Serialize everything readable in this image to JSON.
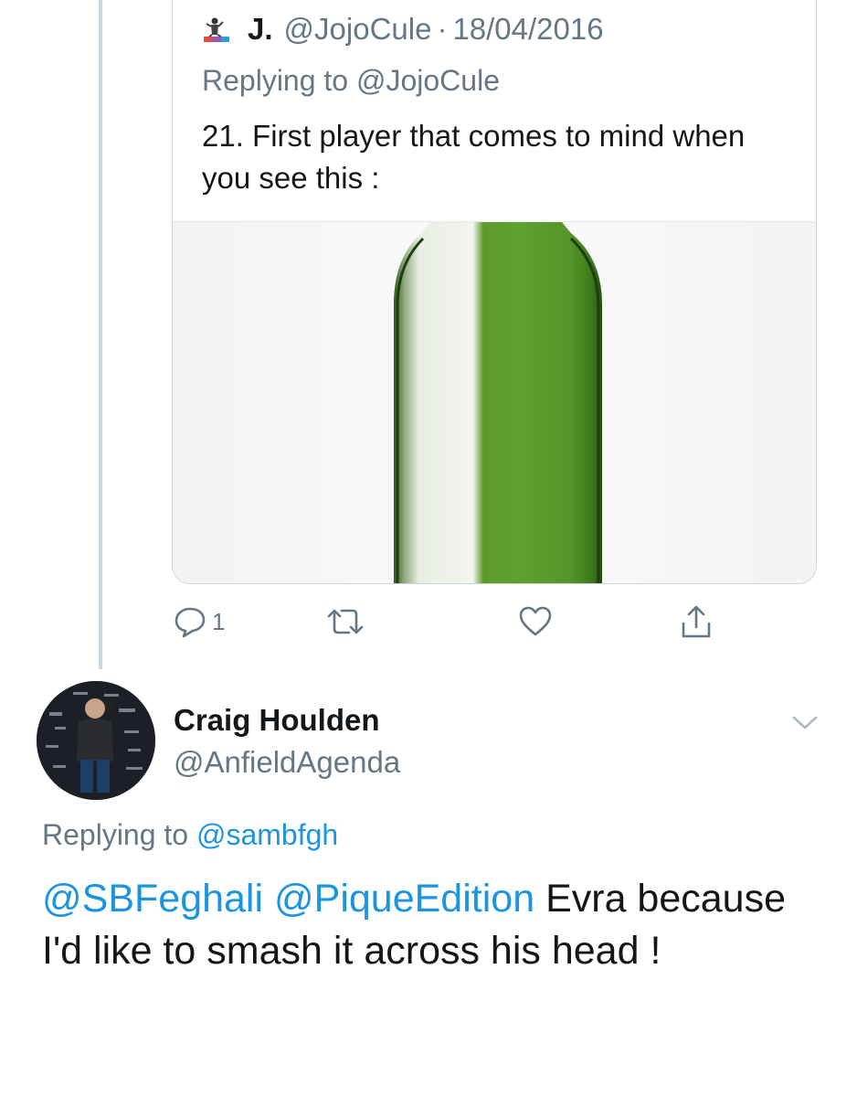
{
  "quoted_tweet": {
    "display_name": "J.",
    "handle": "@JojoCule",
    "separator": "·",
    "date": "18/04/2016",
    "replying_prefix": "Replying to",
    "replying_handle": "@JojoCule",
    "text": "21. First player that comes to mind when you see this :",
    "media_description": "green glass bottle"
  },
  "actions": {
    "reply_count": "1",
    "icons": [
      "reply-icon",
      "retweet-icon",
      "like-icon",
      "share-icon"
    ]
  },
  "reply_tweet": {
    "display_name": "Craig Houlden",
    "handle": "@AnfieldAgenda",
    "replying_prefix": "Replying to",
    "replying_handle": "@sambfgh",
    "mention_1": "@SBFeghali",
    "mention_2": "@PiqueEdition",
    "text": "Evra because I'd like to smash it across his head !"
  },
  "colors": {
    "link": "#1b95e0",
    "secondary_text": "#657786",
    "border": "#ccd6dd",
    "bottle_green": "#5aa02c"
  }
}
